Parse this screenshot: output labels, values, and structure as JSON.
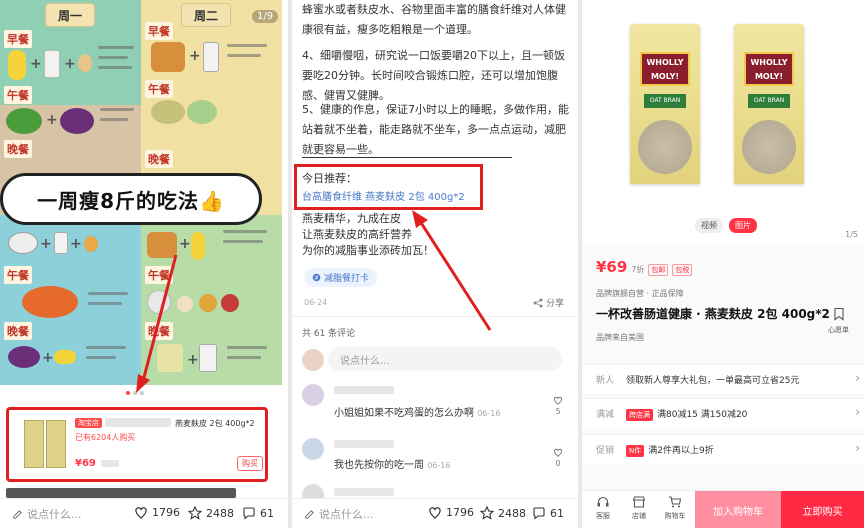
{
  "panel1": {
    "day1": "周一",
    "day2": "周二",
    "page_counter": "1/9",
    "meals": {
      "breakfast": "早餐",
      "lunch": "午餐",
      "dinner": "晚餐"
    },
    "banner": "一周瘦8斤的吃法👍",
    "product": {
      "tag": "淘宝店",
      "name": "燕麦麸皮 2包 400g*2",
      "sold": "已有6204人购买",
      "price": "¥69",
      "buy_label": "购买"
    },
    "bottom": {
      "comment_placeholder": "说点什么...",
      "likes": "1796",
      "favorites": "2488",
      "comments": "61"
    }
  },
  "panel2": {
    "paragraphs": [
      "蜂蜜水或者麸皮水、谷物里面丰富的膳食纤维对人体健康很有益，瘦多吃粗粮是一个道理。",
      "4、细嚼慢咽，研究说一口饭要嚼20下以上，且一顿饭要吃20分钟。长时间咬合锻炼口腔，还可以增加饱腹感、健胃又健脾。",
      "5、健康的作息，保证7小时以上的睡眠，多做作用，能站着就不坐着，能走路就不坐车，多一点点运动，减肥就更容易一些。"
    ],
    "rec_title": "今日推荐：",
    "rec_link": "台高膳食纤维 燕麦麸皮 2包 400g*2",
    "lines": [
      "燕麦精华，九成在皮",
      "让燕麦麸皮的高纤营养",
      "为你的减脂事业添砖加瓦！"
    ],
    "chip": "减脂餐打卡",
    "date": "06-24",
    "share": "分享",
    "comments_total": "共 61 条评论",
    "comment_placeholder": "说点什么...",
    "comments": [
      {
        "text": "小姐姐如果不吃鸡蛋的怎么办啊",
        "date": "06-16",
        "likes": "5"
      },
      {
        "text": "我也先按你的吃一周",
        "date": "06-16",
        "likes": "0"
      }
    ],
    "bottom": {
      "comment_placeholder": "说点什么...",
      "likes": "1796",
      "favorites": "2488",
      "comments": "61"
    }
  },
  "panel3": {
    "bag_brand": "WHOLLY MOLY!",
    "bag_label": "OAT BRAN",
    "tabs": [
      "视频",
      "图片"
    ],
    "page": "1/5",
    "price": "¥69",
    "price_suffix": "7折",
    "badges": [
      "包邮",
      "包税"
    ],
    "guarantee": "品牌旗舰自营 · 正品保障",
    "title": "一杯改善肠道健康 · 燕麦麸皮  2包 400g*2",
    "origin": "品牌来自美国",
    "fav": "心愿单",
    "rows": [
      {
        "label": "新人",
        "badge": "",
        "text": "领取新人尊享大礼包，一单最高可立省25元"
      },
      {
        "label": "满减",
        "badge": "跨店满",
        "text": "满80减15 满150减20"
      },
      {
        "label": "促销",
        "badge": "N件",
        "text": "满2件再以上9折"
      }
    ],
    "bottom_icons": [
      "客服",
      "店铺",
      "购物车"
    ],
    "cart_button": "加入购物车",
    "buy_button": "立即购买",
    "accent": "#ff2a44"
  }
}
